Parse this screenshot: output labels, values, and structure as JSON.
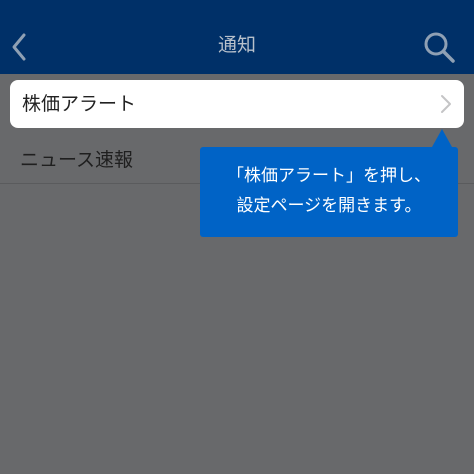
{
  "navbar": {
    "title": "通知",
    "back_icon": "chevron-left-icon",
    "search_icon": "search-icon",
    "background_color": "#003068"
  },
  "list": {
    "items": [
      {
        "label": "株価アラート",
        "highlighted": true,
        "icon": "chevron-right-icon"
      },
      {
        "label": "ニュース速報",
        "highlighted": false
      }
    ]
  },
  "tooltip": {
    "text": "「株価アラート」を押し、\n設定ページを開きます。",
    "background_color": "#0063c6"
  },
  "overlay_color": "#68696b"
}
